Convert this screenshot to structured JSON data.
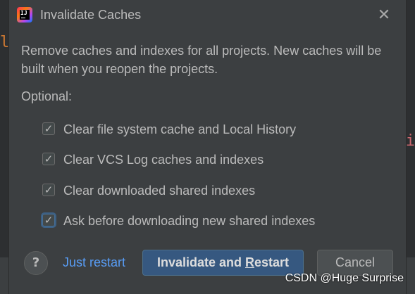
{
  "dialog": {
    "title": "Invalidate Caches",
    "description": "Remove caches and indexes for all projects. New caches will be built when you reopen the projects.",
    "optional_label": "Optional:",
    "close_icon": "close-icon",
    "options": [
      {
        "label": "Clear file system cache and Local History",
        "checked": true
      },
      {
        "label": "Clear VCS Log caches and indexes",
        "checked": true
      },
      {
        "label": "Clear downloaded shared indexes",
        "checked": true
      },
      {
        "label": "Ask before downloading new shared indexes",
        "checked": true
      }
    ],
    "help_symbol": "?",
    "just_restart_label": "Just restart",
    "primary_button": {
      "before": "Invalidate and ",
      "mnemonic": "R",
      "after": "estart"
    },
    "cancel_label": "Cancel"
  },
  "watermark": "CSDN @Huge Surprise",
  "colors": {
    "dialog_bg": "#3c3f41",
    "text": "#bbbbbb",
    "link": "#589df6",
    "primary_button": "#365880"
  }
}
